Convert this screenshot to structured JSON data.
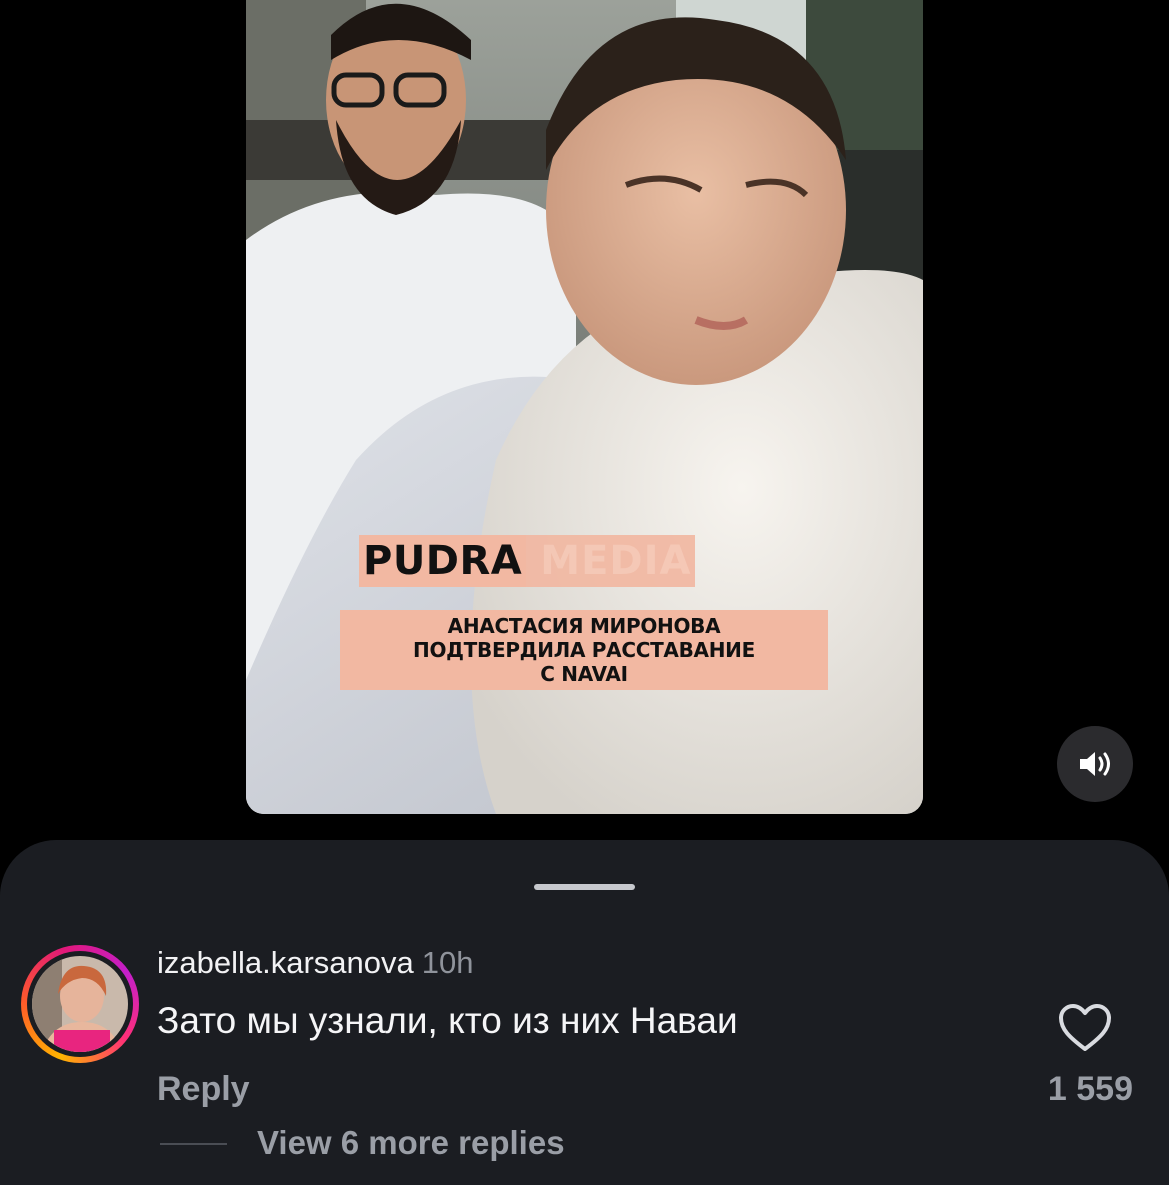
{
  "reel": {
    "brand_word1": "PUDRA",
    "brand_word2": "MEDIA",
    "headline_lines": [
      "АНАСТАСИЯ МИРОНОВА",
      "ПОДТВЕРДИЛА РАССТАВАНИЕ",
      "С NAVAI"
    ],
    "mute_icon": "speaker-icon"
  },
  "comments": {
    "items": [
      {
        "username": "izabella.karsanova",
        "time": "10h",
        "text": "Зато мы узнали, кто из них Наваи",
        "reply_label": "Reply",
        "like_count": "1 559",
        "like_icon": "heart-outline-icon",
        "view_replies": "View 6 more replies"
      }
    ]
  },
  "colors": {
    "background": "#000000",
    "sheet": "#1b1d22",
    "accent_peach": "#f2b8a2",
    "muted_text": "#9a9ea6"
  }
}
